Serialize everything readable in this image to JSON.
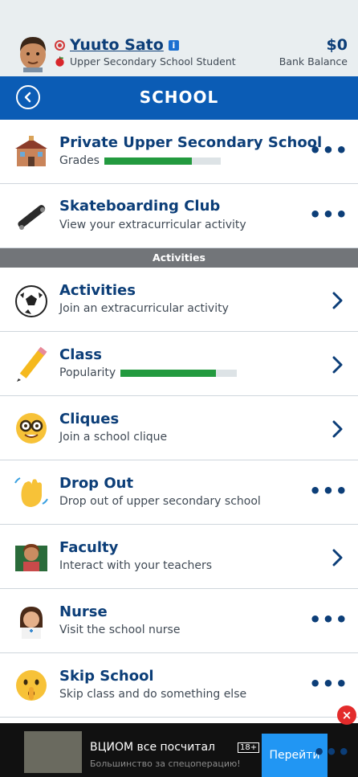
{
  "header": {
    "name": "Yuuto Sato",
    "role": "Upper Secondary School Student",
    "money": "$0",
    "money_label": "Bank Balance"
  },
  "titlebar": {
    "title": "SCHOOL"
  },
  "top_rows": [
    {
      "label": "Private Upper Secondary School",
      "desc": "Grades",
      "progress": 0.75,
      "icon": "school-building-icon",
      "action": "more"
    },
    {
      "label": "Skateboarding Club",
      "desc": "View your extracurricular activity",
      "icon": "skateboard-icon",
      "action": "more"
    }
  ],
  "section_header": "Activities",
  "rows": [
    {
      "label": "Activities",
      "desc": "Join an extracurricular activity",
      "icon": "soccer-ball-icon",
      "action": "chevron"
    },
    {
      "label": "Class",
      "desc": "Popularity",
      "progress": 0.82,
      "icon": "pencil-icon",
      "action": "chevron"
    },
    {
      "label": "Cliques",
      "desc": "Join a school clique",
      "icon": "nerd-face-icon",
      "action": "chevron"
    },
    {
      "label": "Drop Out",
      "desc": "Drop out of upper secondary school",
      "icon": "waving-hand-icon",
      "action": "more"
    },
    {
      "label": "Faculty",
      "desc": "Interact with your teachers",
      "icon": "teacher-icon",
      "action": "chevron"
    },
    {
      "label": "Nurse",
      "desc": "Visit the school nurse",
      "icon": "nurse-icon",
      "action": "more"
    },
    {
      "label": "Skip School",
      "desc": "Skip class and do something else",
      "icon": "shushing-face-icon",
      "action": "more"
    }
  ],
  "ad": {
    "headline": "ВЦИОМ все посчитал",
    "subtext": "Большинство за спецоперацию!",
    "age": "18+",
    "cta": "Перейти",
    "close": "×"
  },
  "colors": {
    "accent": "#0b5cb5",
    "progress": "#239a3f",
    "section": "#727579"
  }
}
